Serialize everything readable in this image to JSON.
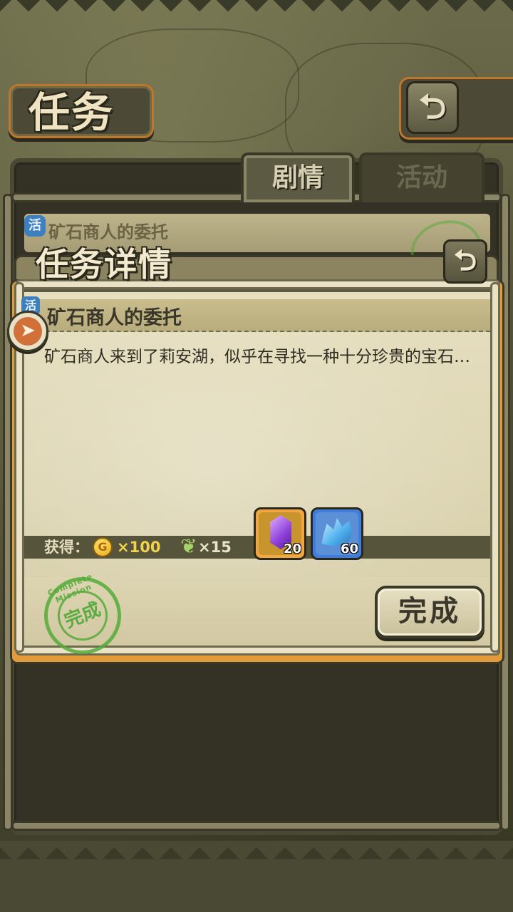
{
  "header": {
    "title": "任务",
    "back_icon": "return-arrow-icon"
  },
  "tabs": [
    {
      "label": "剧情",
      "active": true
    },
    {
      "label": "活动",
      "active": false
    }
  ],
  "list": {
    "row_tag": "活",
    "row_title": "矿石商人的委托"
  },
  "detail": {
    "title": "任务详情",
    "back_icon": "return-arrow-icon",
    "mission_tag": "活",
    "mission_name": "矿石商人的委托",
    "description": "矿石商人来到了莉安湖，似乎在寻找一种十分珍贵的宝石…",
    "rewards_label": "获得：",
    "gold_icon_glyph": "G",
    "gold_amount": "×100",
    "feather_amount": "×15",
    "items": [
      {
        "icon": "purple-gem-icon",
        "count": "20"
      },
      {
        "icon": "blue-ore-icon",
        "count": "60"
      }
    ],
    "stamp_text": "完成",
    "stamp_ring": "Complete Mission",
    "complete_button": "完成"
  },
  "colors": {
    "accent_orange": "#e29a3b",
    "gold": "#f1d34b",
    "stamp_green": "#54aa3a",
    "gem_slot": "#f2a640",
    "ore_slot": "#3f7ce0"
  }
}
